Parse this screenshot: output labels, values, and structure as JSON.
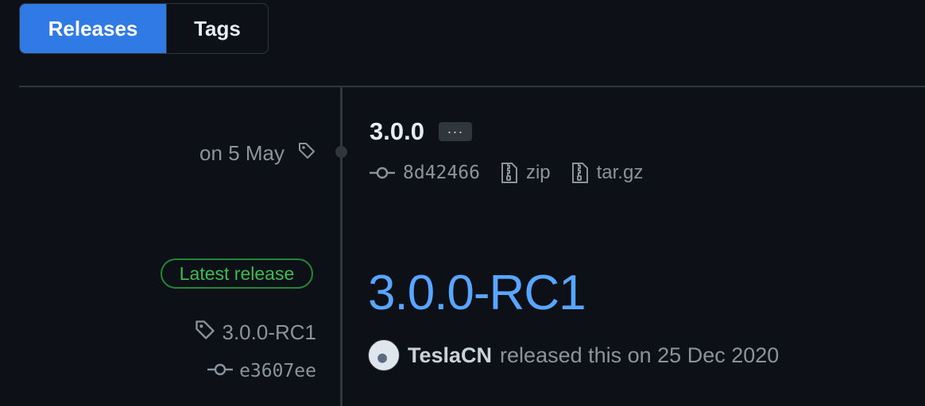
{
  "tabs": [
    {
      "label": "Releases",
      "active": true
    },
    {
      "label": "Tags",
      "active": false
    }
  ],
  "release_one": {
    "date": "on 5 May",
    "title": "3.0.0",
    "more_label": "···",
    "commit": "8d42466",
    "assets": [
      "zip",
      "tar.gz"
    ]
  },
  "release_two": {
    "badge": "Latest release",
    "tag": "3.0.0-RC1",
    "commit": "e3607ee",
    "title": "3.0.0-RC1",
    "author": "TeslaCN",
    "released_text": "released this on 25 Dec 2020"
  },
  "colors": {
    "background": "#0d1117",
    "accent": "#2f7ae5",
    "link": "#58a6ff",
    "latest_badge": "#3fb950"
  },
  "icons": [
    "tag-icon",
    "commit-icon",
    "file-zip-icon",
    "avatar"
  ]
}
